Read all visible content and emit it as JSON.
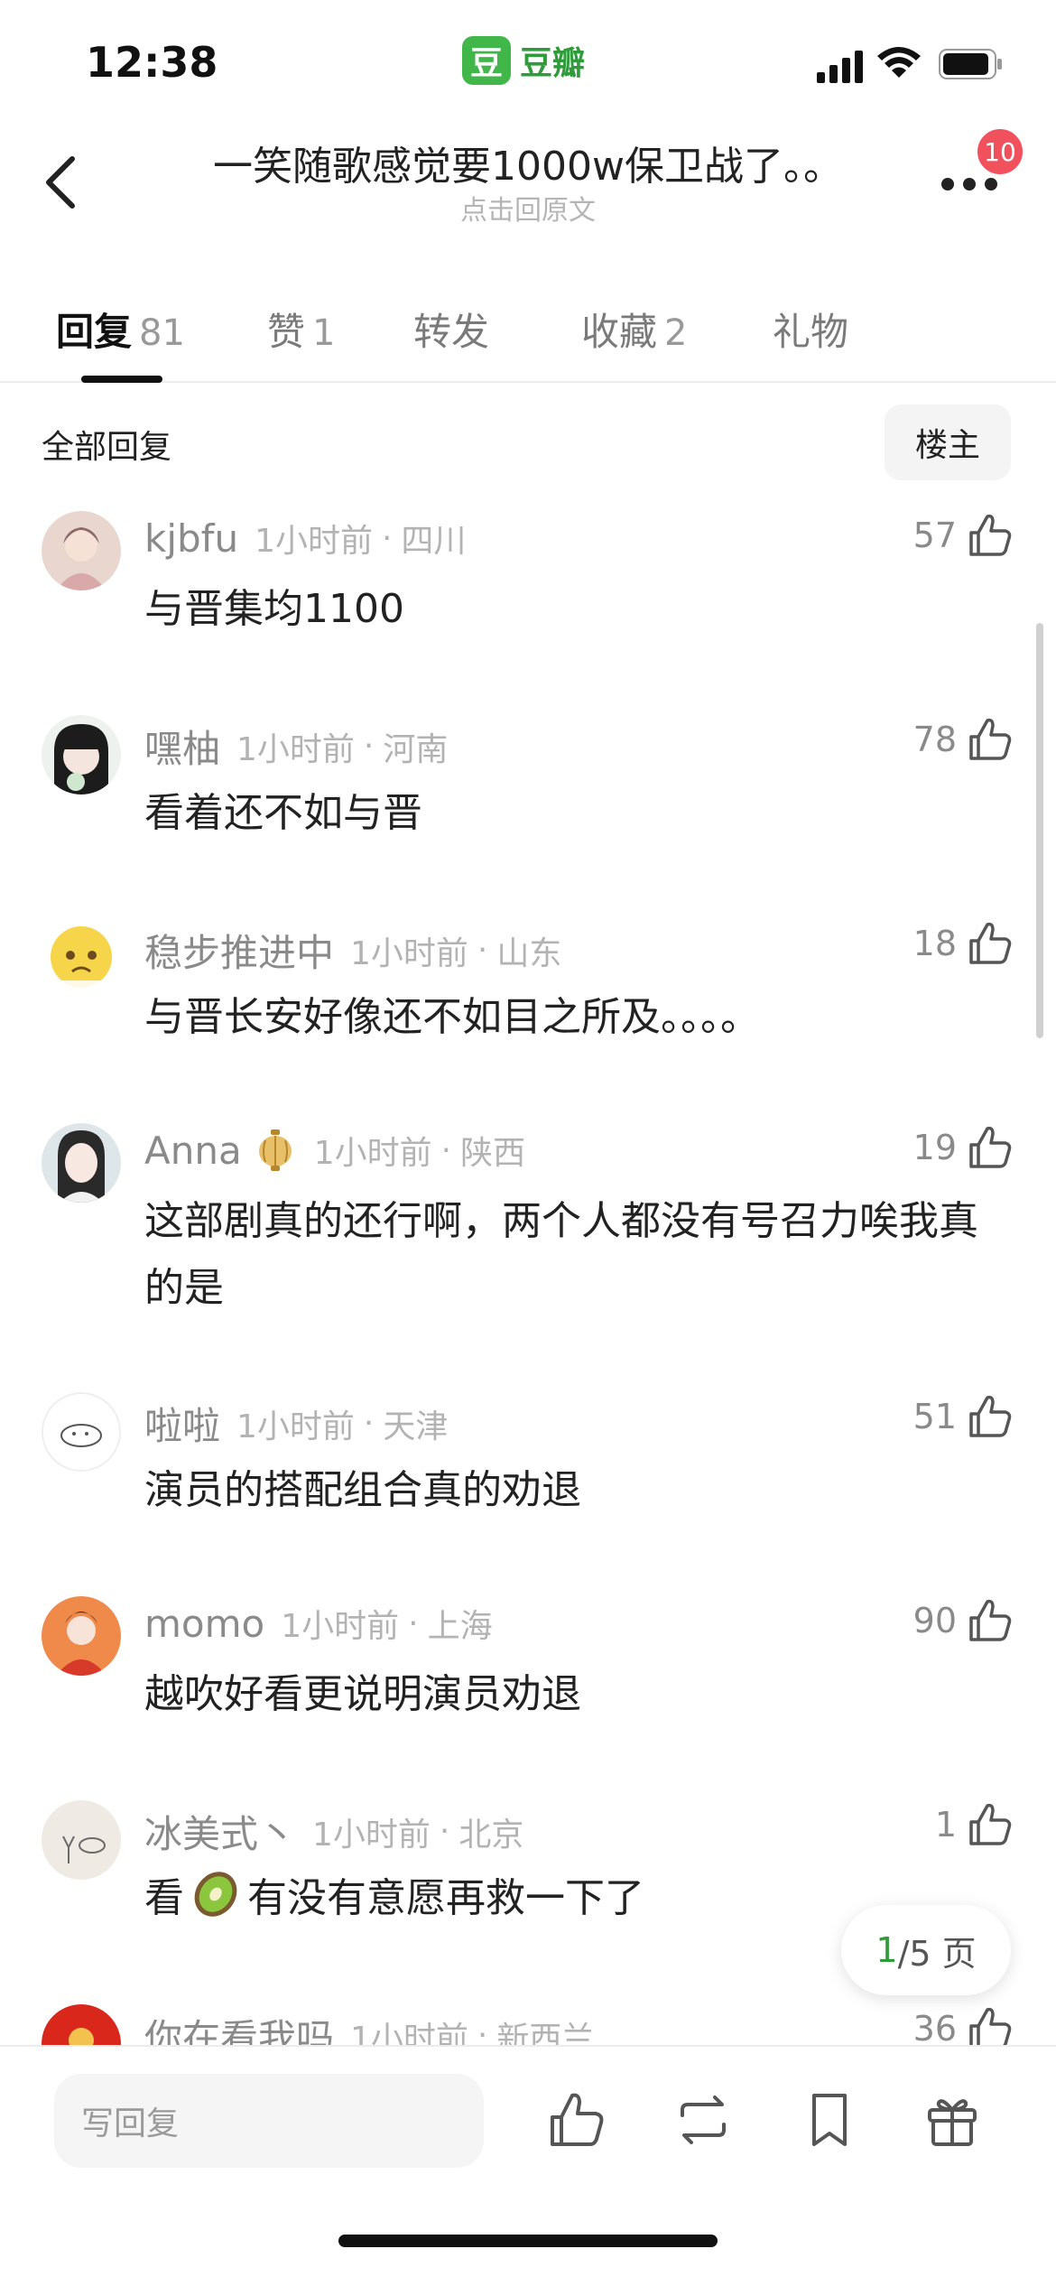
{
  "status_bar": {
    "time": "12:38",
    "app_logo": "豆",
    "app_name": "豆瓣"
  },
  "nav": {
    "title": "一笑随歌感觉要1000w保卫战了。。",
    "subtitle": "点击回原文",
    "notification_count": "10"
  },
  "tabs": [
    {
      "label": "回复",
      "count": "81"
    },
    {
      "label": "赞",
      "count": "1"
    },
    {
      "label": "转发",
      "count": ""
    },
    {
      "label": "收藏",
      "count": "2"
    },
    {
      "label": "礼物",
      "count": ""
    }
  ],
  "section": {
    "title": "全部回复",
    "filter_label": "楼主"
  },
  "comments": [
    {
      "user": "kjbfu",
      "ago": "1小时前",
      "location": "四川",
      "text": "与晋集均1100",
      "likes": "57"
    },
    {
      "user": "嘿柚",
      "ago": "1小时前",
      "location": "河南",
      "text": "看着还不如与晋",
      "likes": "78"
    },
    {
      "user": "稳步推进中",
      "ago": "1小时前",
      "location": "山东",
      "text": "与晋长安好像还不如目之所及。。。。",
      "likes": "18"
    },
    {
      "user": "Anna",
      "ago": "1小时前",
      "location": "陕西",
      "text": "这部剧真的还行啊，两个人都没有号召力唉我真的是",
      "likes": "19"
    },
    {
      "user": "啦啦",
      "ago": "1小时前",
      "location": "天津",
      "text": "演员的搭配组合真的劝退",
      "likes": "51"
    },
    {
      "user": "momo",
      "ago": "1小时前",
      "location": "上海",
      "text": "越吹好看更说明演员劝退",
      "likes": "90"
    },
    {
      "user": "冰美式丶",
      "ago": "1小时前",
      "location": "北京",
      "text_before": "看",
      "text_after": "有没有意愿再救一下了",
      "likes": "1"
    },
    {
      "user": "你在看我吗",
      "ago": "1小时前",
      "location": "新西兰",
      "text": "",
      "likes": "36"
    }
  ],
  "pager": {
    "current": "1",
    "rest": "/5 页"
  },
  "bottom_bar": {
    "reply_placeholder": "写回复"
  },
  "colors": {
    "accent_green": "#41b649",
    "notification_red": "#f0515c"
  },
  "icons": [
    "back-icon",
    "more-icon",
    "like-icon",
    "repost-icon",
    "bookmark-icon",
    "gift-icon"
  ]
}
